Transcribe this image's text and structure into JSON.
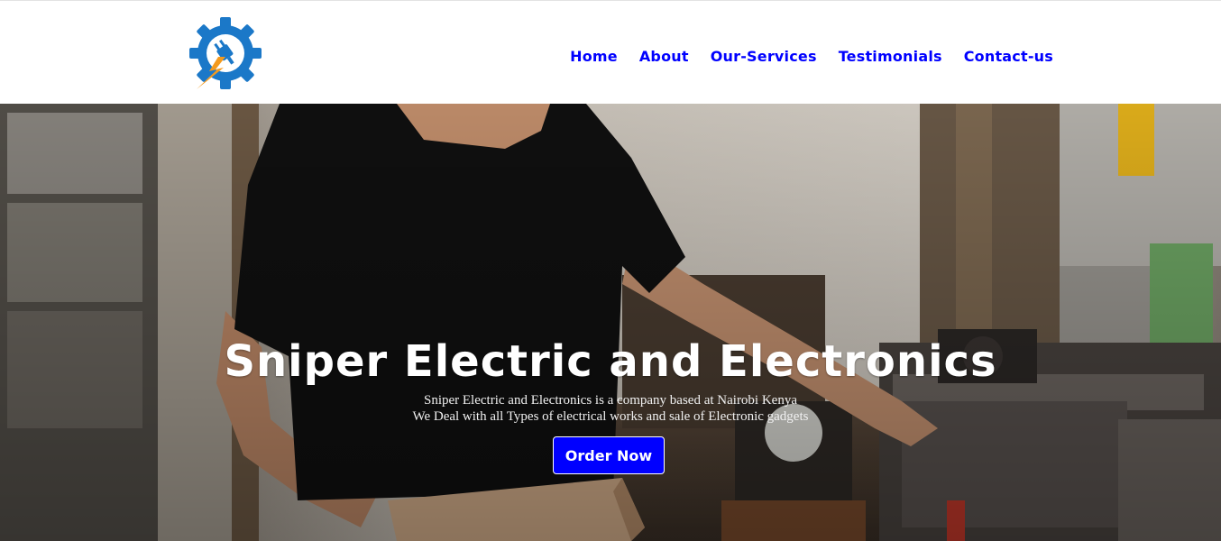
{
  "header": {
    "logo_icon": "gear-plug-lightning-icon",
    "colors": {
      "logo_blue": "#1b78c8",
      "logo_orange": "#f39a1e"
    }
  },
  "nav": {
    "items": [
      {
        "label": "Home"
      },
      {
        "label": "About"
      },
      {
        "label": "Our-Services"
      },
      {
        "label": "Testimonials"
      },
      {
        "label": "Contact-us"
      }
    ],
    "color": "#0000ff"
  },
  "hero": {
    "title": "Sniper Electric and Electronics",
    "subtitle_line1": "Sniper Electric and Electronics is a company based at Nairobi Kenya",
    "subtitle_line2": "We Deal with all Types of electrical works and sale of Electronic gadgets",
    "cta_label": "Order Now",
    "cta_color": "#0000ff",
    "background_image": "man-in-black-tshirt-using-wood-planer-in-workshop"
  }
}
